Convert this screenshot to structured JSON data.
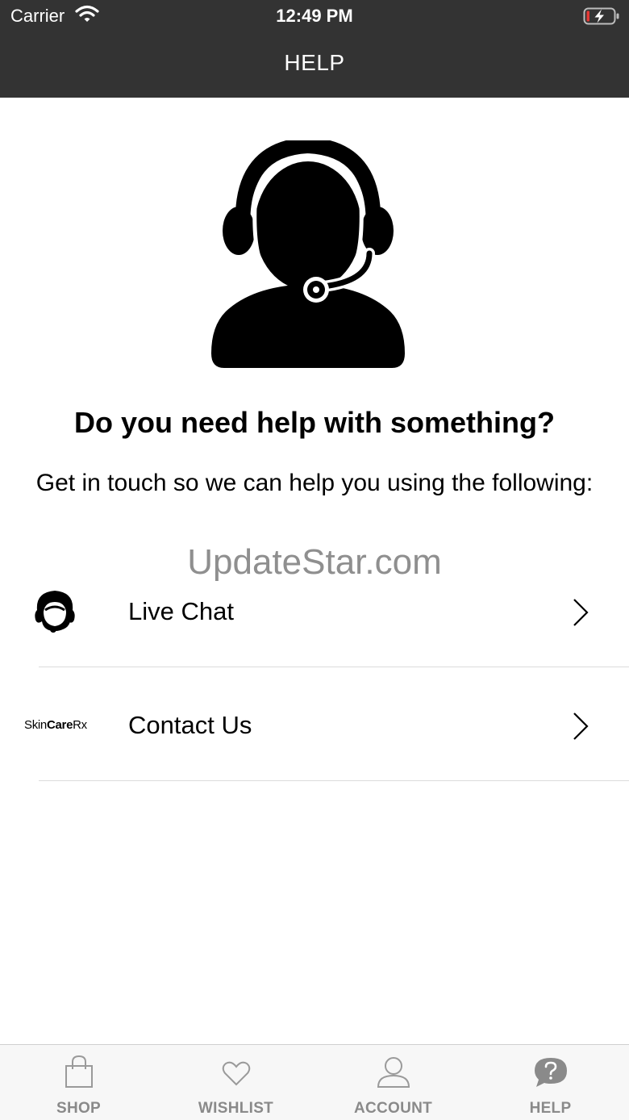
{
  "status_bar": {
    "carrier": "Carrier",
    "time": "12:49 PM"
  },
  "header": {
    "title": "HELP"
  },
  "main": {
    "headline": "Do you need help with something?",
    "subline": "Get in touch so we can help you using the following:",
    "watermark": "UpdateStar.com",
    "options": [
      {
        "label": "Live Chat",
        "icon": "agent-icon"
      },
      {
        "label": "Contact Us",
        "icon": "skincarerx-logo",
        "logo_text_light": "Skin",
        "logo_text_bold": "Care",
        "logo_text_end": "Rx"
      }
    ]
  },
  "tab_bar": {
    "items": [
      {
        "label": "SHOP",
        "icon": "bag-icon"
      },
      {
        "label": "WISHLIST",
        "icon": "heart-icon"
      },
      {
        "label": "ACCOUNT",
        "icon": "person-icon"
      },
      {
        "label": "HELP",
        "icon": "question-icon"
      }
    ]
  },
  "colors": {
    "bar_bg": "#333333",
    "tab_inactive": "#8a8a8a",
    "divider": "#dcdcdc"
  }
}
